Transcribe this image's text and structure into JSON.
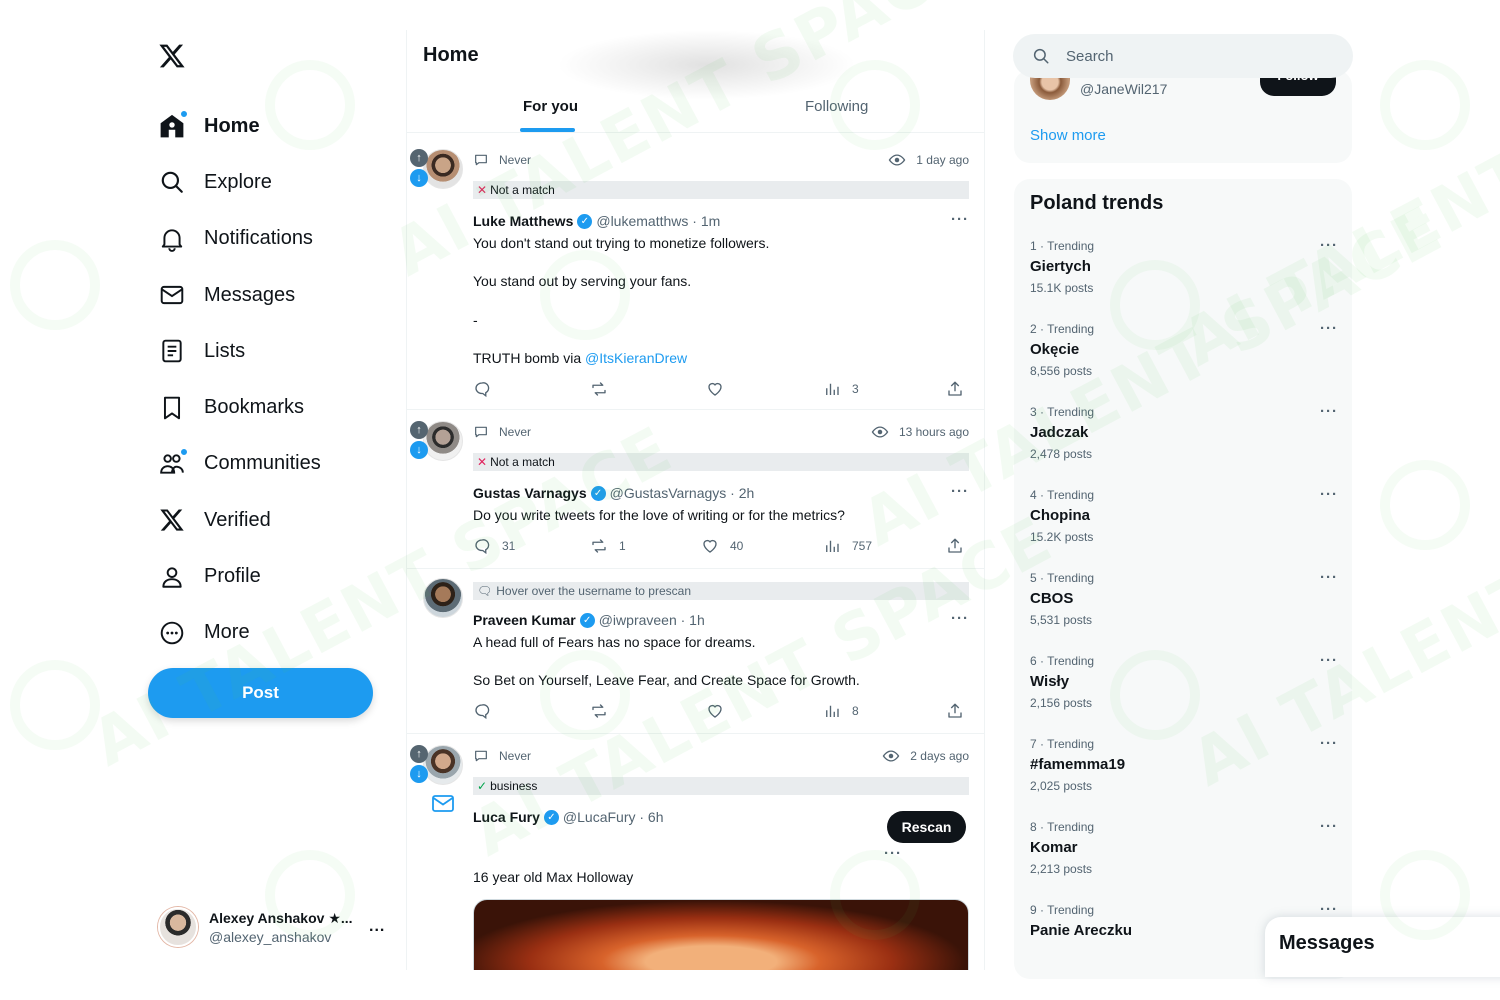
{
  "sidebar": {
    "nav": [
      {
        "label": "Home",
        "icon": "home-icon",
        "active": true,
        "badge": true
      },
      {
        "label": "Explore",
        "icon": "search-icon"
      },
      {
        "label": "Notifications",
        "icon": "bell-icon"
      },
      {
        "label": "Messages",
        "icon": "envelope-icon"
      },
      {
        "label": "Lists",
        "icon": "list-icon"
      },
      {
        "label": "Bookmarks",
        "icon": "bookmark-icon"
      },
      {
        "label": "Communities",
        "icon": "communities-icon",
        "badge": true
      },
      {
        "label": "Verified",
        "icon": "x-logo-icon"
      },
      {
        "label": "Profile",
        "icon": "person-icon"
      },
      {
        "label": "More",
        "icon": "more-circle-icon"
      }
    ],
    "post_label": "Post",
    "account": {
      "name": "Alexey Anshakov ★...",
      "handle": "@alexey_anshakov",
      "more": "..."
    }
  },
  "main": {
    "title": "Home",
    "tabs": [
      "For you",
      "Following"
    ],
    "active_tab": "For you",
    "tweets": [
      {
        "status": "Never",
        "time": "1 day ago",
        "tag": "Not a match",
        "name": "Luke Matthews",
        "handle": "@lukematthws · 1m",
        "lines": [
          "You don't stand out trying to monetize followers.",
          "You stand out by serving your fans.",
          "-",
          "TRUTH bomb via "
        ],
        "link": "@ItsKieranDrew",
        "stats": {
          "replies": "",
          "reposts": "",
          "likes": "",
          "views": "3"
        }
      },
      {
        "status": "Never",
        "time": "13 hours ago",
        "tag": "Not a match",
        "name": "Gustas Varnagys",
        "handle": "@GustasVarnagys · 2h",
        "lines": [
          "Do you write tweets for the love of writing or for the metrics?"
        ],
        "stats": {
          "replies": "31",
          "reposts": "1",
          "likes": "40",
          "views": "757"
        }
      },
      {
        "tag": "Hover over the username to prescan",
        "name": "Praveen Kumar",
        "handle": "@iwpraveen · 1h",
        "lines": [
          "A head full of Fears has no space for dreams.",
          "So Bet on Yourself, Leave Fear, and Create Space for Growth."
        ],
        "stats": {
          "replies": "",
          "reposts": "",
          "likes": "",
          "views": "8"
        }
      },
      {
        "status": "Never",
        "time": "2 days ago",
        "tag": "business",
        "name": "Luca Fury",
        "handle": "@LucaFury · 6h",
        "lines": [
          "16 year old Max Holloway"
        ],
        "rescan_label": "Rescan"
      }
    ],
    "more": "···"
  },
  "right": {
    "search_placeholder": "Search",
    "who_to_follow": {
      "handle": "@JaneWil217",
      "follow_label": "Follow",
      "show_more": "Show more"
    },
    "trends_title": "Poland trends",
    "trends": [
      {
        "context": "1 · Trending",
        "name": "Giertych",
        "posts": "15.1K posts"
      },
      {
        "context": "2 · Trending",
        "name": "Okęcie",
        "posts": "8,556 posts"
      },
      {
        "context": "3 · Trending",
        "name": "Jadczak",
        "posts": "2,478 posts"
      },
      {
        "context": "4 · Trending",
        "name": "Chopina",
        "posts": "15.2K posts"
      },
      {
        "context": "5 · Trending",
        "name": "CBOS",
        "posts": "5,531 posts"
      },
      {
        "context": "6 · Trending",
        "name": "Wisły",
        "posts": "2,156 posts"
      },
      {
        "context": "7 · Trending",
        "name": "#famemma19",
        "posts": "2,025 posts"
      },
      {
        "context": "8 · Trending",
        "name": "Komar",
        "posts": "2,213 posts"
      },
      {
        "context": "9 · Trending",
        "name": "Panie Areczku",
        "posts": ""
      }
    ],
    "messages_drawer": "Messages"
  },
  "watermark": "AI TALENT SPACE",
  "colors": {
    "accent": "#1d9bf0",
    "text": "#0f1419",
    "muted": "#536471",
    "watermark": "#5acd5a"
  }
}
